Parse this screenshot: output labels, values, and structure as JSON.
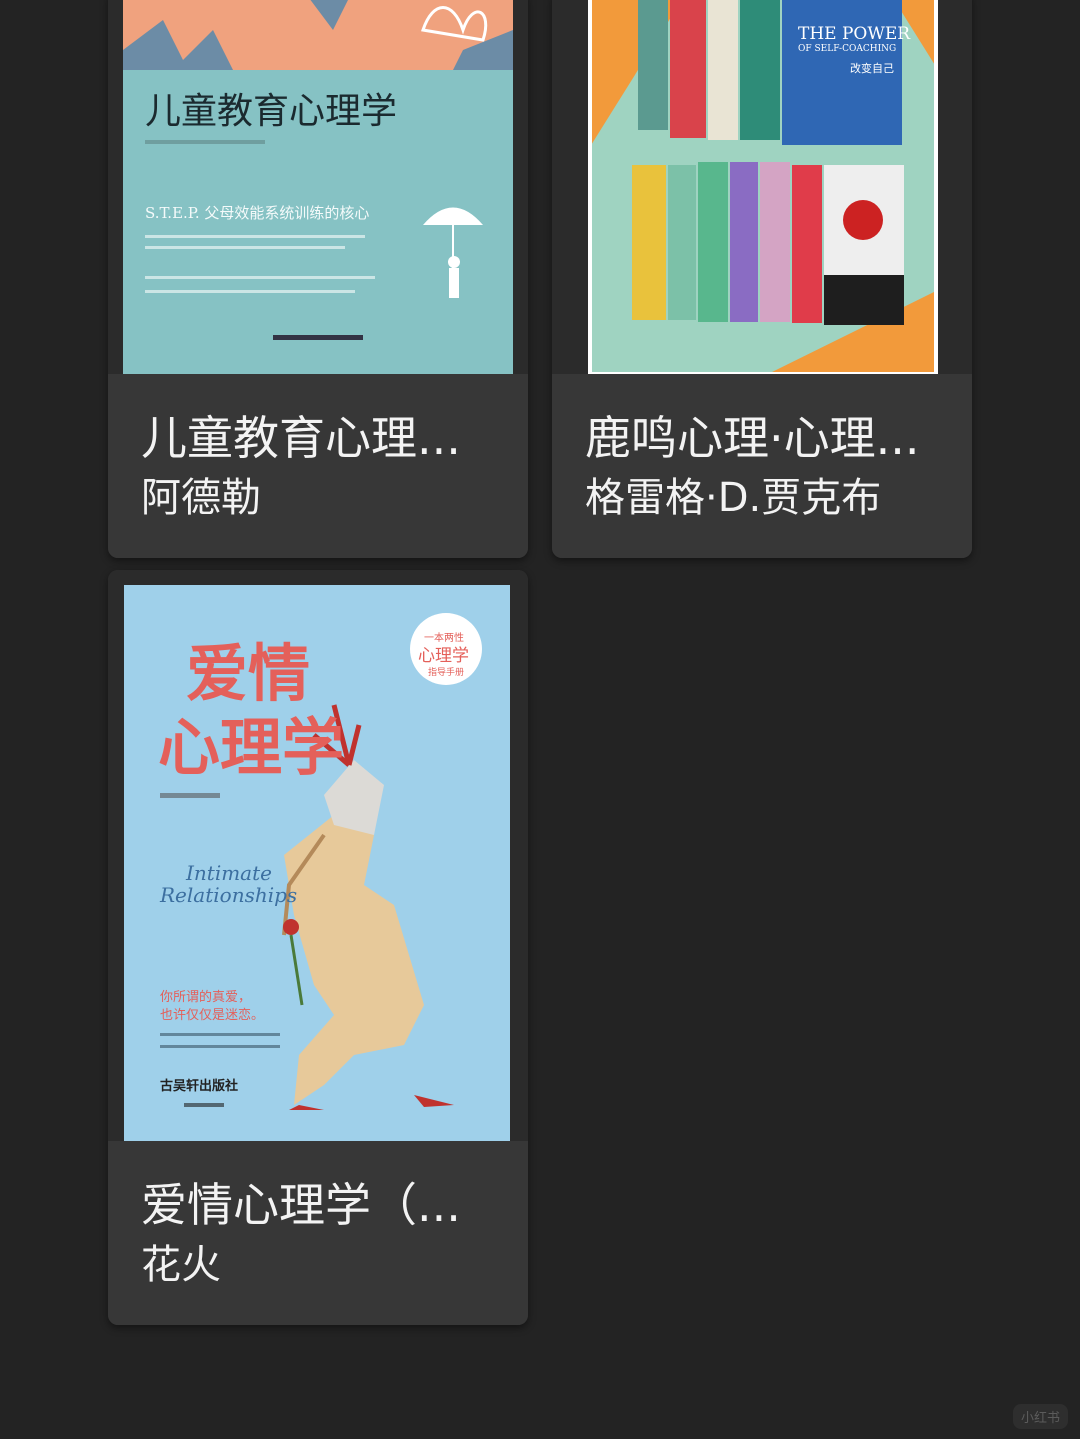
{
  "books": [
    {
      "title": "儿童教育心理...",
      "author": "阿德勒",
      "cover": {
        "title": "儿童教育心理学",
        "subtitle": "S.T.E.P. 父母效能系统训练的核心",
        "colors": {
          "top": "#f0a27e",
          "main": "#86c2c4"
        }
      }
    },
    {
      "title": "鹿鸣心理·心理...",
      "author": "格雷格·D.贾克布",
      "cover": {
        "spine_text": "THE POWER",
        "spine_sub": "OF SELF-COACHING",
        "spine_cn": "改变自己",
        "colors": {
          "bg": "#9fd3c1",
          "accent": "#f29a3b"
        }
      }
    },
    {
      "title": "爱情心理学（...",
      "author": "花火",
      "cover": {
        "title_line1": "爱情",
        "title_line2": "心理学",
        "badge_line1": "一本两性",
        "badge_line2": "心理学",
        "badge_line3": "指导手册",
        "english_line1": "Intimate",
        "english_line2": "Relationships",
        "tagline": "你所谓的真爱，\n也许仅仅是迷恋。",
        "publisher": "古吴轩出版社",
        "colors": {
          "bg": "#9fd0ea",
          "title": "#e4605a"
        }
      }
    }
  ],
  "watermark": "小红书"
}
